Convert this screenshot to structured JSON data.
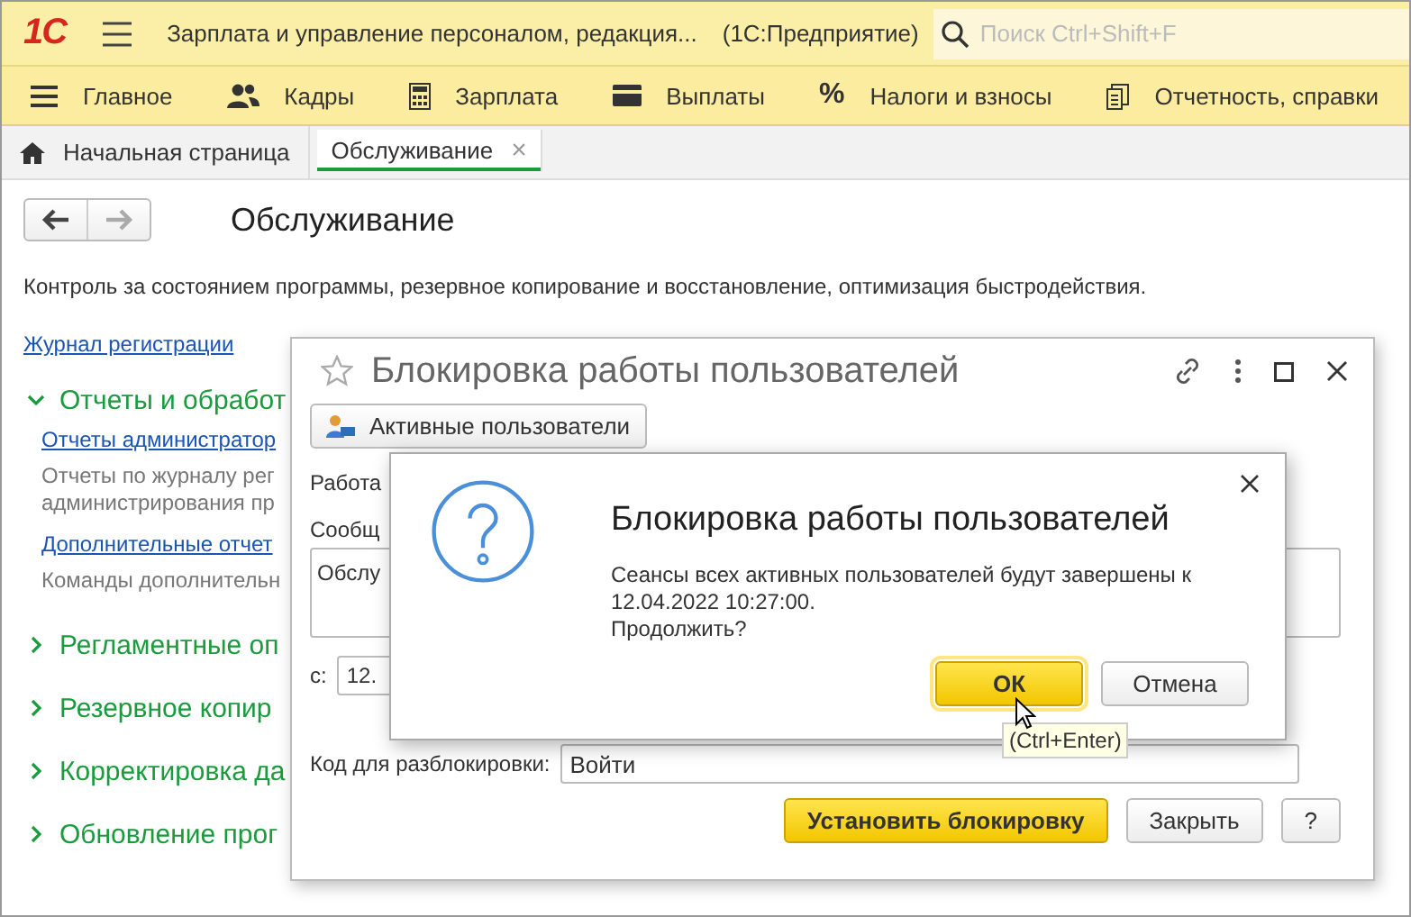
{
  "app_bar": {
    "logo": "1С",
    "title": "Зарплата и управление персоналом, редакция...",
    "app_name": "(1С:Предприятие)",
    "search": {
      "placeholder": "Поиск Ctrl+Shift+F"
    }
  },
  "sections": [
    {
      "label": "Главное",
      "kind": "lines"
    },
    {
      "label": "Кадры",
      "kind": "people"
    },
    {
      "label": "Зарплата",
      "kind": "calculator"
    },
    {
      "label": "Выплаты",
      "kind": "card"
    },
    {
      "label": "Налоги и взносы",
      "kind": "glyph",
      "glyph": "%"
    },
    {
      "label": "Отчетность, справки",
      "kind": "documents"
    }
  ],
  "tabs": [
    {
      "label": "Начальная страница",
      "selected": false,
      "kind": "home"
    },
    {
      "label": "Обслуживание",
      "selected": true,
      "kind": "closable",
      "close": "×"
    }
  ],
  "page": {
    "title": "Обслуживание",
    "description": "Контроль за состоянием программы, резервное копирование и восстановление, оптимизация быстродействия.",
    "links": [
      "Журнал регистрации"
    ],
    "groups": [
      {
        "title": "Отчеты и обработ",
        "expanded": true,
        "items": [
          {
            "link": "Отчеты администратор",
            "note_lines": [
              "Отчеты по журналу рег",
              "администрирования пр"
            ]
          },
          {
            "link": "Дополнительные отчет",
            "note_lines": [
              "Команды дополнительн"
            ]
          }
        ]
      },
      {
        "title": "Регламентные оп",
        "expanded": false
      },
      {
        "title": "Резервное копир",
        "expanded": false
      },
      {
        "title": "Корректировка да",
        "expanded": false
      },
      {
        "title": "Обновление прог",
        "expanded": false
      }
    ]
  },
  "form_window": {
    "title": "Блокировка работы пользователей",
    "favorite": false,
    "toolbar_button": "Активные пользователи",
    "work_label": "Работа",
    "message_label": "Сообщ",
    "message_value": "Обслу",
    "from_label": "с:",
    "from_value": "12.",
    "code_label": "Код для разблокировки:",
    "code_value": "Войти",
    "buttons": [
      {
        "label": "Установить блокировку",
        "default": true
      },
      {
        "label": "Закрыть",
        "default": false
      },
      {
        "label": "?",
        "default": false
      }
    ]
  },
  "confirm_dialog": {
    "title": "Блокировка работы пользователей",
    "message_lines": [
      "Сеансы всех активных пользователей будут завершены к",
      "12.04.2022 10:27:00.",
      "Продолжить?"
    ],
    "buttons": [
      {
        "label": "ОК",
        "default": true
      },
      {
        "label": "Отмена",
        "default": false
      }
    ],
    "tooltip": "(Ctrl+Enter)"
  }
}
